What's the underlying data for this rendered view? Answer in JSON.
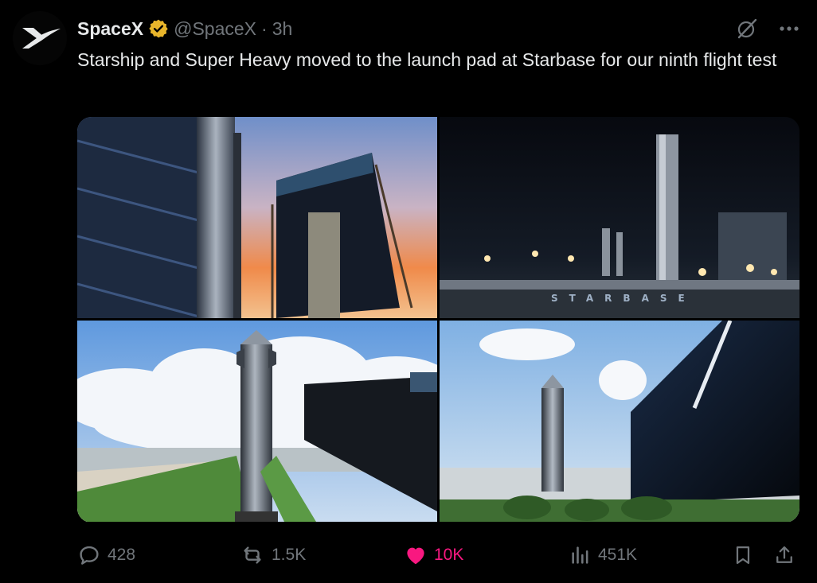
{
  "post": {
    "author_name": "SpaceX",
    "handle": "@SpaceX",
    "separator": "·",
    "time": "3h",
    "text": "Starship and Super Heavy moved to the launch pad at Starbase for our ninth flight test"
  },
  "media": {
    "tile3_sign_text": "STARBASE"
  },
  "actions": {
    "replies": "428",
    "reposts": "1.5K",
    "likes": "10K",
    "views": "451K"
  },
  "icons": {
    "avatar": "spacex-logo",
    "verified": "verified-badge-icon",
    "grok": "grok-icon",
    "more": "more-icon",
    "reply": "reply-icon",
    "repost": "repost-icon",
    "like": "heart-icon",
    "views": "views-icon",
    "bookmark": "bookmark-icon",
    "share": "share-icon"
  },
  "colors": {
    "background": "#000000",
    "text": "#e7e9ea",
    "muted": "#71767b",
    "like": "#f91880",
    "verified": "#e8b52b"
  }
}
